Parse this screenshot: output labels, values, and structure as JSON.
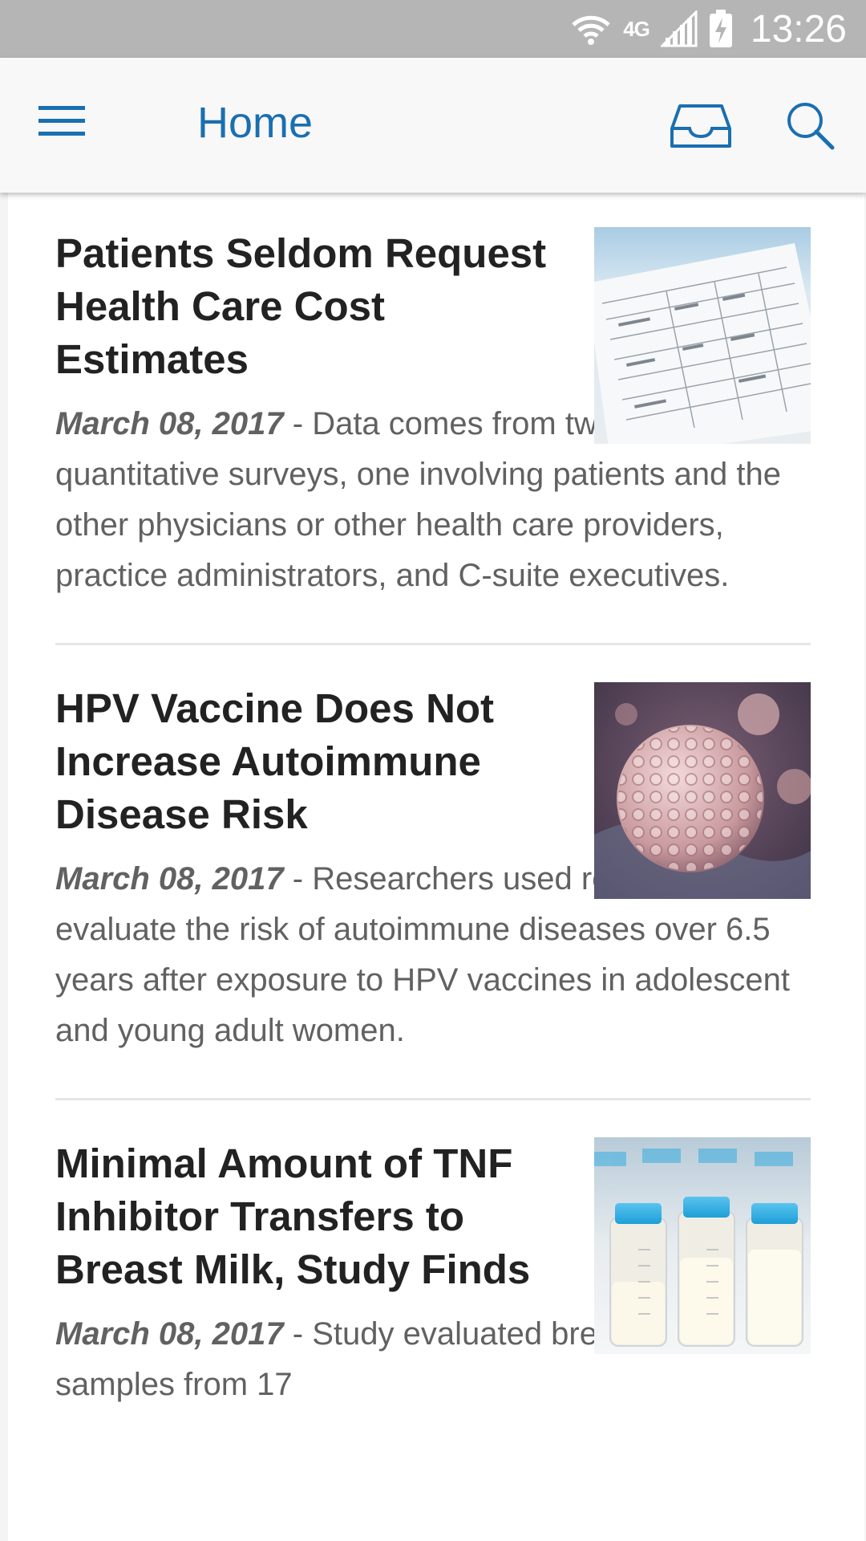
{
  "status_bar": {
    "time": "13:26",
    "network": "4G",
    "icons": [
      "wifi-icon",
      "network-4g-icon",
      "signal-icon",
      "battery-charging-icon"
    ]
  },
  "app_bar": {
    "title": "Home",
    "icons": [
      "menu-icon",
      "inbox-icon",
      "search-icon"
    ],
    "accent_color": "#1a6fb0"
  },
  "articles": [
    {
      "title": "Patients Seldom Request Health Care Cost Estimates",
      "date": "March 08, 2017",
      "separator": " - ",
      "summary": "Data comes from two combined quantitative surveys, one involving patients and the other physicians or other health care providers, practice administrators, and C-suite executives.",
      "image": "medical-bill-statement-image"
    },
    {
      "title": "HPV Vaccine Does Not Increase Autoimmune Disease Risk",
      "date": "March 08, 2017",
      "separator": " - ",
      "summary": "Researchers used registry data to evaluate the risk of autoimmune diseases over 6.5 years after exposure to HPV vaccines in adolescent and young adult women.",
      "image": "hpv-virus-particle-image"
    },
    {
      "title": "Minimal Amount of TNF Inhibitor Transfers to Breast Milk, Study Finds",
      "date": "March 08, 2017",
      "separator": " - ",
      "summary": "Study evaluated breast milk samples from 17",
      "image": "breast-milk-bottles-image"
    }
  ]
}
